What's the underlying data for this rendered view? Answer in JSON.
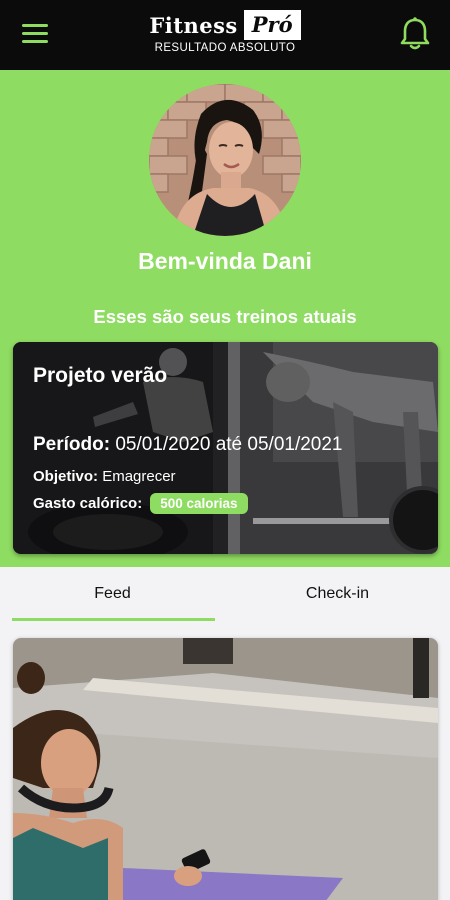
{
  "header": {
    "brand_word": "Fitness",
    "brand_badge": "Pró",
    "brand_tagline": "RESULTADO ABSOLUTO",
    "accent_color": "#8fdc62",
    "menu_icon": "hamburger-menu-icon",
    "notification_icon": "bell-icon"
  },
  "profile": {
    "greeting": "Bem-vinda Dani",
    "subtitle": "Esses são seus treinos atuais"
  },
  "plan": {
    "title": "Projeto verão",
    "period_label": "Período:",
    "period_value": "05/01/2020 até 05/01/2021",
    "goal_label": "Objetivo:",
    "goal_value": "Emagrecer",
    "calories_label": "Gasto calórico:",
    "calories_value": "500 calorias"
  },
  "tabs": [
    {
      "label": "Feed",
      "active": true
    },
    {
      "label": "Check-in",
      "active": false
    }
  ]
}
